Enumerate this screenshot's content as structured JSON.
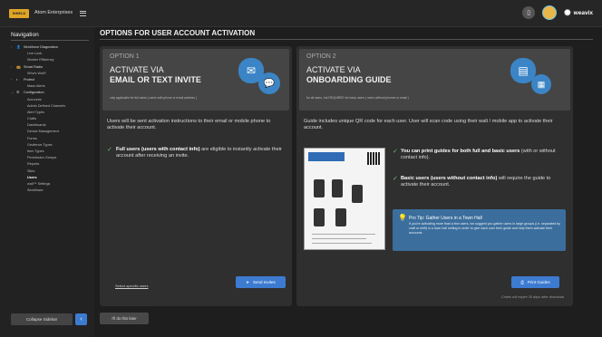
{
  "header": {
    "logo_text": "SHIELD",
    "org_name": "Atom Enterprises",
    "brand": "weavix",
    "brand_icon": "weavix-logo-icon",
    "colors": {
      "accent": "#3d7bd1",
      "logo": "#e0a526",
      "tip": "#3b6e9c",
      "check": "#6cc070"
    }
  },
  "sidebar": {
    "title": "Navigation",
    "items": [
      {
        "label": "Workforce Diagnostics",
        "type": "group",
        "icon": "person-icon"
      },
      {
        "label": "Live Look",
        "type": "sub"
      },
      {
        "label": "Worker Efficiency",
        "type": "sub"
      },
      {
        "label": "Smart Radio",
        "type": "group",
        "icon": "radio-icon"
      },
      {
        "label": "Who's Wolf?",
        "type": "sub"
      },
      {
        "label": "Protect",
        "type": "group",
        "icon": "shield-icon"
      },
      {
        "label": "Mass Alerts",
        "type": "sub"
      },
      {
        "label": "Configuration",
        "type": "group-open",
        "icon": "gear-icon"
      },
      {
        "label": "Accounts",
        "type": "sub"
      },
      {
        "label": "Admin Defined Channels",
        "type": "sub"
      },
      {
        "label": "Alert Types",
        "type": "sub"
      },
      {
        "label": "Crafts",
        "type": "sub"
      },
      {
        "label": "Dashboards",
        "type": "sub"
      },
      {
        "label": "Device Management",
        "type": "sub"
      },
      {
        "label": "Forms",
        "type": "sub"
      },
      {
        "label": "Geofence Types",
        "type": "sub"
      },
      {
        "label": "Item Types",
        "type": "sub"
      },
      {
        "label": "Permission Groups",
        "type": "sub"
      },
      {
        "label": "Reports",
        "type": "sub"
      },
      {
        "label": "Sites",
        "type": "sub"
      },
      {
        "label": "Users",
        "type": "sub-active"
      },
      {
        "label": "walt™ Settings",
        "type": "sub"
      },
      {
        "label": "Workflows",
        "type": "sub"
      }
    ],
    "collapse_label": "Collapse Sidebar"
  },
  "main": {
    "title": "OPTIONS FOR  USER ACCOUNT ACTIVATION",
    "option1": {
      "label": "OPTION 1",
      "heading_line1": "ACTIVATE VIA",
      "heading_line2": "EMAIL OR TEXT INVITE",
      "note": "only applicable for full users ( users with phone or email address )",
      "description": "Users will be sent activation instructions to their email or mobile phone to activate their account.",
      "point_bold": "Full users (users with contact info)",
      "point_rest": " are eligible to instantly activate their account after receiving an invite.",
      "link": "Select specific users",
      "button": "Send Invites"
    },
    "option2": {
      "label": "OPTION 2",
      "heading_line1": "ACTIVATE VIA",
      "heading_line2": "ONBOARDING GUIDE",
      "note": "for all users, but REQUIRED for basic users ( users without phones or email )",
      "description": "Guide includes unique QR code for each user. User will scan code using their walt / mobile app to activate their account.",
      "point1_bold": "You can print guides for both full and basic users",
      "point1_rest": " (with or without contact info).",
      "point2_bold": "Basic users (users without contact info)",
      "point2_rest": " will require the guide to activate their account.",
      "tip_title": "Pro Tip: Gather Users in a Town Hall",
      "tip_text": "If you're activating more than a few users, we suggest you gather users in large groups (i.e. separated by craft or shift) in a town hall setting in order to give each user their guide and help them activate their accounts.",
      "button": "Print Guides",
      "expire": "Codes will expire 30 days after download"
    },
    "later_button": "I'll do this later"
  }
}
